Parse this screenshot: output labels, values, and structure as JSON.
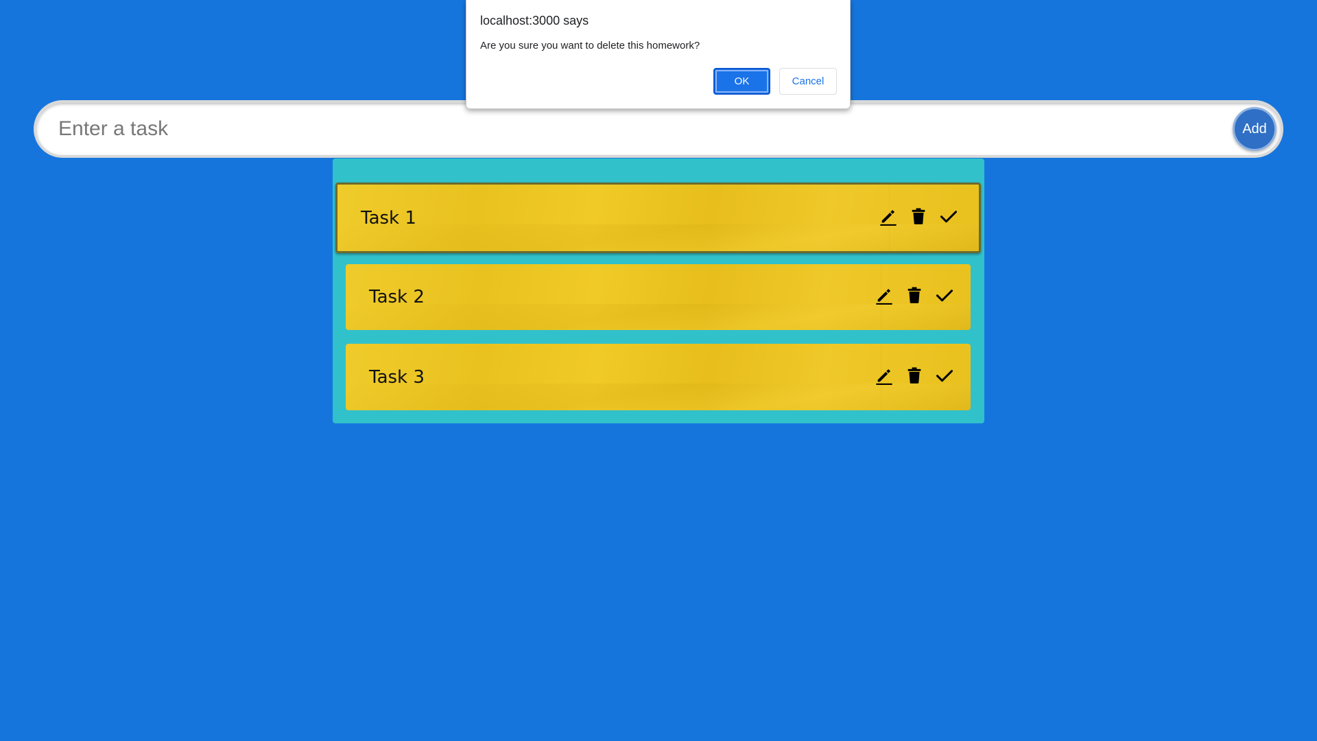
{
  "input": {
    "placeholder": "Enter a task",
    "value": "",
    "add_label": "Add"
  },
  "tasks": [
    {
      "label": "Task 1",
      "selected": true
    },
    {
      "label": "Task 2",
      "selected": false
    },
    {
      "label": "Task 3",
      "selected": false
    }
  ],
  "dialog": {
    "title": "localhost:3000 says",
    "message": "Are you sure you want to delete this homework?",
    "ok_label": "OK",
    "cancel_label": "Cancel"
  },
  "icons": {
    "edit": "pencil-icon",
    "delete": "trash-icon",
    "complete": "checkmark-icon"
  },
  "colors": {
    "background": "#1675DD",
    "panel": "#31C1CB",
    "card": "#EFC827",
    "add_button": "#2F6FC5",
    "dialog_ok": "#1A73E8"
  }
}
